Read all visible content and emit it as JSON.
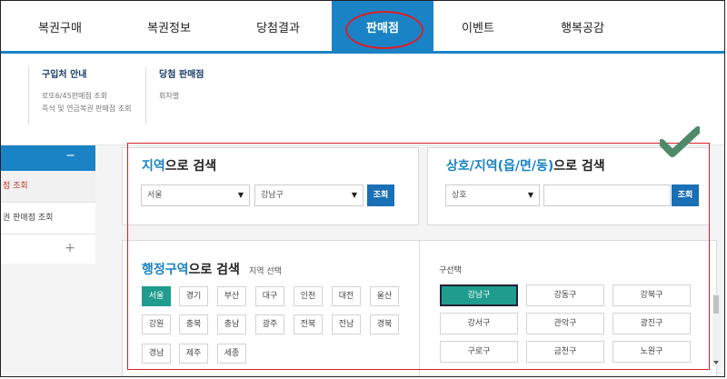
{
  "nav": {
    "items": [
      {
        "label": "복권구매"
      },
      {
        "label": "복권정보"
      },
      {
        "label": "당첨결과"
      },
      {
        "label": "판매점",
        "active": true
      },
      {
        "label": "이벤트"
      },
      {
        "label": "행복공감"
      }
    ]
  },
  "submenu": {
    "col1": {
      "head": "구입처 안내",
      "links": [
        "로또6/45판매점 조회",
        "즉석 및 연금복권 판매점 조회"
      ]
    },
    "col2": {
      "head": "당첨 판매점",
      "links": [
        "회차별"
      ]
    }
  },
  "sidebar": {
    "head_symbol": "−",
    "items": [
      "점 조회",
      "권 판매점 조회"
    ],
    "plus_symbol": "+"
  },
  "region_search": {
    "title_hl": "지역",
    "title_rest": "으로 검색",
    "sido": "서울",
    "gugun": "강남구",
    "button": "조회"
  },
  "shop_search": {
    "title_hl": "상호/지역(읍/면/동)",
    "title_rest": "으로 검색",
    "select": "상호",
    "input_value": "",
    "button": "조회"
  },
  "admin_search": {
    "title_hl": "행정구역",
    "title_rest": "으로 검색",
    "sub_note": "지역 선택",
    "regions": [
      "서울",
      "경기",
      "부산",
      "대구",
      "인천",
      "대전",
      "울산",
      "강원",
      "충북",
      "충남",
      "광주",
      "전북",
      "전남",
      "경북",
      "경남",
      "제주",
      "세종"
    ],
    "selected_region": "서울",
    "gu_label": "구선택",
    "gus": [
      "강남구",
      "강동구",
      "강북구",
      "강서구",
      "관악구",
      "광진구",
      "구로구",
      "금천구",
      "노원구"
    ],
    "selected_gu": "강남구"
  },
  "colors": {
    "accent": "#1a83c5",
    "teal": "#1f9c8e",
    "annotation": "#d8202a",
    "check": "#4e8a6a"
  }
}
